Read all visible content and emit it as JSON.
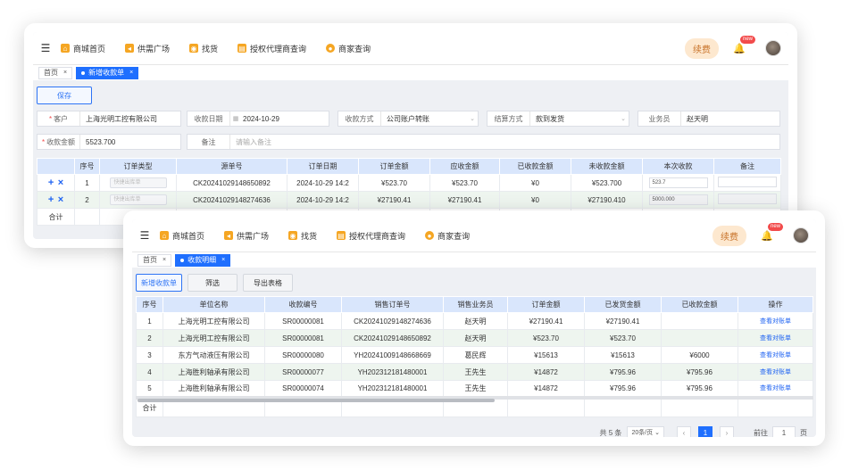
{
  "nav": {
    "items": [
      {
        "label": "商城首页",
        "icon": "home-icon",
        "color": "#f5a623"
      },
      {
        "label": "供需广场",
        "icon": "megaphone-icon",
        "color": "#f5a623"
      },
      {
        "label": "找货",
        "icon": "search-goods-icon",
        "color": "#f5a623"
      },
      {
        "label": "授权代理商查询",
        "icon": "document-icon",
        "color": "#f5a623"
      },
      {
        "label": "商家查询",
        "icon": "merchant-icon",
        "color": "#f5a623"
      }
    ],
    "renew_label": "续费",
    "badge": "new"
  },
  "window1": {
    "tabs": [
      {
        "label": "首页"
      },
      {
        "label": "新增收款单"
      }
    ],
    "save_label": "保存",
    "form": {
      "customer_label": "客户",
      "customer_value": "上海光明工控有限公司",
      "date_label": "收款日期",
      "date_value": "2024-10-29",
      "method_label": "收款方式",
      "method_value": "公司账户转账",
      "settle_label": "结算方式",
      "settle_value": "款到发货",
      "sales_label": "业务员",
      "sales_value": "赵天明",
      "amount_label": "收款金额",
      "amount_value": "5523.700",
      "remark_label": "备注",
      "remark_placeholder": "请输入备注"
    },
    "table": {
      "headers": [
        "序号",
        "订单类型",
        "源单号",
        "订单日期",
        "订单金额",
        "应收金额",
        "已收款金额",
        "未收款金额",
        "本次收款",
        "备注"
      ],
      "rows": [
        {
          "no": "1",
          "type": "快捷出库单",
          "source": "CK20241029148650892",
          "date": "2024-10-29 14:2",
          "order_amt": "¥523.70",
          "receivable": "¥523.70",
          "received": "¥0",
          "unreceived": "¥523.700",
          "this_time": "523.7",
          "remark": ""
        },
        {
          "no": "2",
          "type": "快捷出库单",
          "source": "CK20241029148274636",
          "date": "2024-10-29 14:2",
          "order_amt": "¥27190.41",
          "receivable": "¥27190.41",
          "received": "¥0",
          "unreceived": "¥27190.410",
          "this_time": "5000.000",
          "remark": ""
        }
      ],
      "total_label": "合计"
    }
  },
  "window2": {
    "tabs": [
      {
        "label": "首页"
      },
      {
        "label": "收款明细"
      }
    ],
    "buttons": {
      "add": "新增收款单",
      "filter": "筛选",
      "export": "导出表格"
    },
    "table": {
      "headers": [
        "序号",
        "单位名称",
        "收款编号",
        "销售订单号",
        "销售业务员",
        "订单金额",
        "已发货金额",
        "已收款金额",
        "操作"
      ],
      "rows": [
        {
          "no": "1",
          "company": "上海光明工控有限公司",
          "code": "SR00000081",
          "order": "CK20241029148274636",
          "sales": "赵天明",
          "amount": "¥27190.41",
          "shipped": "¥27190.41",
          "received": "",
          "op": "查看对账单"
        },
        {
          "no": "2",
          "company": "上海光明工控有限公司",
          "code": "SR00000081",
          "order": "CK20241029148650892",
          "sales": "赵天明",
          "amount": "¥523.70",
          "shipped": "¥523.70",
          "received": "",
          "op": "查看对账单"
        },
        {
          "no": "3",
          "company": "东方气动液压有限公司",
          "code": "SR00000080",
          "order": "YH20241009148668669",
          "sales": "葛民辉",
          "amount": "¥15613",
          "shipped": "¥15613",
          "received": "¥6000",
          "op": "查看对账单"
        },
        {
          "no": "4",
          "company": "上海胜利轴承有限公司",
          "code": "SR00000077",
          "order": "YH202312181480001",
          "sales": "王先生",
          "amount": "¥14872",
          "shipped": "¥795.96",
          "received": "¥795.96",
          "op": "查看对账单"
        },
        {
          "no": "5",
          "company": "上海胜利轴承有限公司",
          "code": "SR00000074",
          "order": "YH202312181480001",
          "sales": "王先生",
          "amount": "¥14872",
          "shipped": "¥795.96",
          "received": "¥795.96",
          "op": "查看对账单"
        }
      ],
      "total_label": "合计"
    },
    "pager": {
      "total": "共 5 条",
      "size": "20条/页",
      "page": "1",
      "goto_label": "前往",
      "goto_value": "1",
      "page_unit": "页"
    }
  }
}
